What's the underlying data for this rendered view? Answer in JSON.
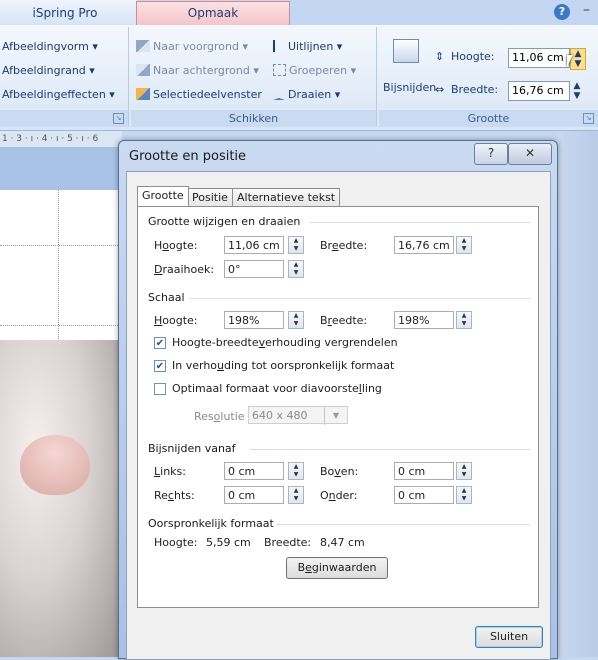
{
  "ribbon": {
    "tabs": {
      "ispring": "iSpring Pro",
      "opmaak": "Opmaak"
    },
    "help_glyph": "?",
    "minimize_glyph": "–",
    "shape_styles": {
      "vorm": "Afbeeldingvorm",
      "rand": "Afbeeldingrand",
      "effecten": "Afbeeldingeffecten"
    },
    "arrange": {
      "voorgrond": "Naar voorgrond",
      "achtergrond": "Naar achtergrond",
      "selectie": "Selectiedeelvenster",
      "uitlijnen": "Uitlijnen",
      "groeperen": "Groeperen",
      "draaien": "Draaien",
      "group_label": "Schikken"
    },
    "size": {
      "bijsnijden": "Bijsnijden",
      "hoogte_label": "Hoogte:",
      "hoogte_value": "11,06 cm",
      "breedte_label": "Breedte:",
      "breedte_value": "16,76 cm",
      "group_label": "Grootte"
    }
  },
  "ruler": {
    "text": "1 · 3 · ı · 4 · ı · 5 · ı · 6"
  },
  "dialog": {
    "title": "Grootte en positie",
    "help_btn": "?",
    "close_btn": "✕",
    "tabs": [
      "Grootte",
      "Positie",
      "Alternatieve tekst"
    ],
    "section_resize": "Grootte wijzigen en draaien",
    "resize": {
      "hoogte": {
        "pre": "H",
        "acc": "o",
        "post": "ogte:",
        "value": "11,06 cm"
      },
      "breedte": {
        "pre": "Br",
        "acc": "e",
        "post": "edte:",
        "value": "16,76 cm"
      },
      "draaihoek": {
        "pre": "",
        "acc": "D",
        "post": "raaihoek:",
        "value": "0°"
      }
    },
    "section_schaal": "Schaal",
    "schaal": {
      "hoogte": {
        "pre": "",
        "acc": "H",
        "post": "oogte:",
        "value": "198%"
      },
      "breedte": {
        "pre": "B",
        "acc": "r",
        "post": "eedte:",
        "value": "198%"
      }
    },
    "checkboxes": [
      {
        "pre": "Hoogte-breedte",
        "acc": "v",
        "post": "erhouding vergrendelen",
        "checked": true
      },
      {
        "pre": "In verho",
        "acc": "u",
        "post": "ding tot oorspronkelijk formaat",
        "checked": true
      },
      {
        "pre": "Optimaal formaat voor diavoorste",
        "acc": "l",
        "post": "ling",
        "checked": false
      }
    ],
    "resolutie": {
      "pre": "Res",
      "acc": "o",
      "post": "lutie",
      "value": "640 x 480"
    },
    "section_bijsnijden": "Bijsnijden vanaf",
    "crop": {
      "links": {
        "pre": "",
        "acc": "L",
        "post": "inks:",
        "value": "0 cm"
      },
      "boven": {
        "pre": "Bo",
        "acc": "v",
        "post": "en:",
        "value": "0 cm"
      },
      "rechts": {
        "pre": "Re",
        "acc": "c",
        "post": "hts:",
        "value": "0 cm"
      },
      "onder": {
        "pre": "O",
        "acc": "n",
        "post": "der:",
        "value": "0 cm"
      }
    },
    "section_orig": "Oorspronkelijk formaat",
    "orig": {
      "hoogte_label": "Hoogte:",
      "hoogte_value": "5,59 cm",
      "breedte_label": "Breedte:",
      "breedte_value": "8,47 cm"
    },
    "reset": {
      "pre": "B",
      "acc": "e",
      "post": "ginwaarden"
    },
    "close_label": "Sluiten"
  },
  "colors": {
    "accent": "#3a78c9",
    "context_tab": "#f4c6ca"
  }
}
